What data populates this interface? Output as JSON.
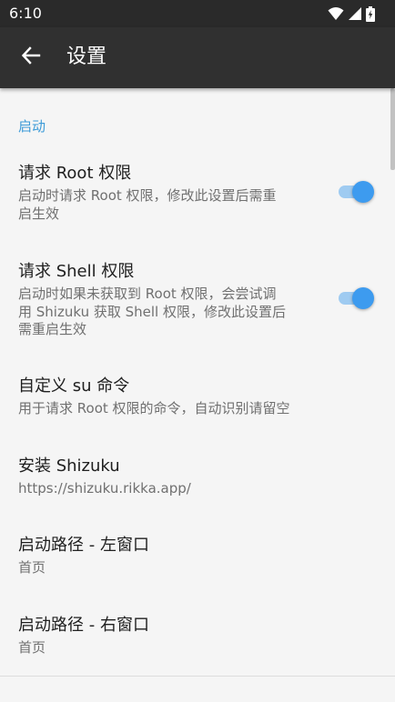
{
  "status_bar": {
    "time": "6:10",
    "icons": [
      "wifi-icon",
      "cellular-signal-icon",
      "battery-charging-icon"
    ]
  },
  "app_bar": {
    "title": "设置",
    "back_icon": "arrow-back-icon"
  },
  "section": {
    "header": "启动"
  },
  "prefs": {
    "request_root": {
      "title": "请求 Root 权限",
      "summary_1": "启动时请求 Root 权限，修改此设置后需重",
      "summary_2": "启生效",
      "enabled": true
    },
    "request_shell": {
      "title": "请求 Shell 权限",
      "summary_1": "启动时如果未获取到 Root 权限，会尝试调",
      "summary_2": "用 Shizuku 获取 Shell 权限，修改此设置后",
      "summary_3": "需重启生效",
      "enabled": true
    },
    "custom_su": {
      "title": "自定义 su 命令",
      "summary": "用于请求 Root 权限的命令，自动识别请留空"
    },
    "install_shizuku": {
      "title": "安装 Shizuku",
      "summary": "https://shizuku.rikka.app/"
    },
    "launch_left": {
      "title": "启动路径 - 左窗口",
      "summary": "首页"
    },
    "launch_right": {
      "title": "启动路径 - 右窗口",
      "summary": "首页"
    }
  },
  "colors": {
    "accent": "#3d9bef",
    "section_header": "#3d9bd8",
    "app_bar": "#303030",
    "background": "#f5f5f5"
  }
}
